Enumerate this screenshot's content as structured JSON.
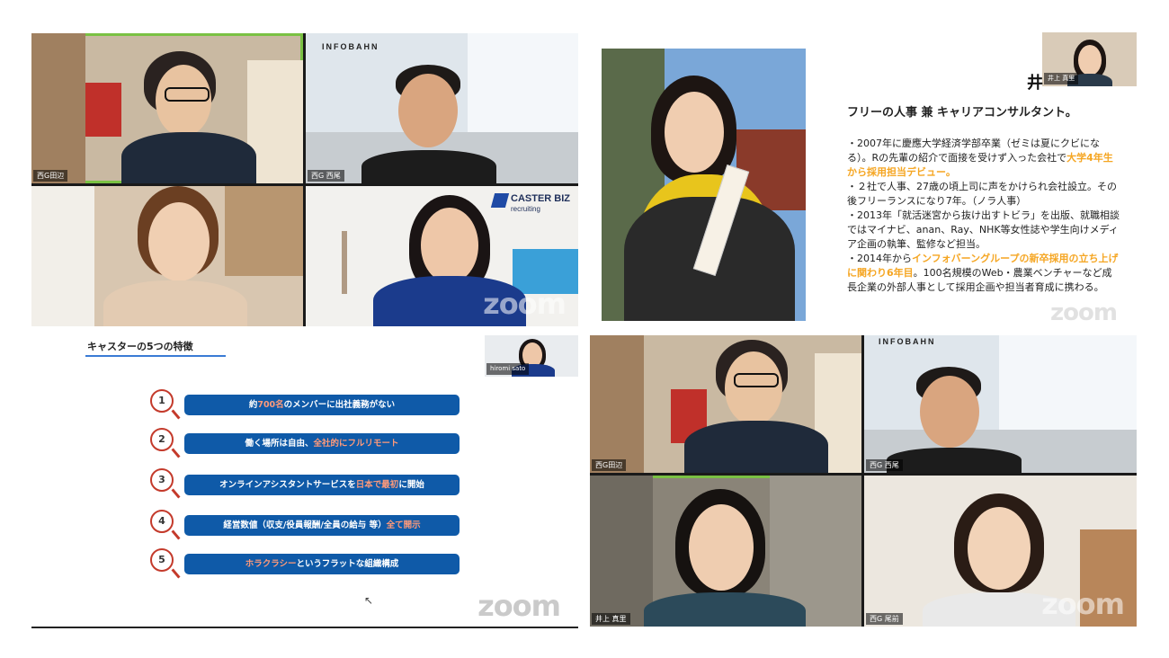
{
  "top_left_grid": {
    "tiles": [
      {
        "name": "西G田辺",
        "highlighted": true
      },
      {
        "name": "西G 西尾",
        "brand": "INFOBAHN"
      },
      {
        "name": ""
      },
      {
        "name": "",
        "brand_line1": "CASTER BIZ",
        "brand_line2": "recruiting"
      }
    ],
    "zoom": "zoom"
  },
  "profile_slide": {
    "name_partial": "井",
    "thumb_name": "井上 真里",
    "headline": "フリーの人事 兼 キャリアコンサルタント。",
    "bullets": [
      {
        "pre": "・2007年に慶應大学経済学部卒業（ゼミは夏にクビになる）。Rの先輩の紹介で面接を受けず入った会社で",
        "hi": "大学4年生から採用担当デビュー。",
        "post": ""
      },
      {
        "pre": "・２社で人事、27歳の頃上司に声をかけられ会社設立。その後フリーランスになり7年。（ノラ人事）",
        "hi": "",
        "post": ""
      },
      {
        "pre": "・2013年「就活迷宮から抜け出すトビラ」を出版、就職相談ではマイナビ、anan、Ray、NHK等女性誌や学生向けメディア企画の執筆、監修など担当。",
        "hi": "",
        "post": ""
      },
      {
        "pre": "・2014年から",
        "hi": "インフォバーングループの新卒採用の立ち上げに関わり6年目",
        "post": "。100名規模のWeb・農業ベンチャーなど成長企業の外部人事として採用企画や担当者育成に携わる。"
      }
    ],
    "zoom": "zoom"
  },
  "caster_slide": {
    "title": "キャスターの5つの特徴",
    "thumb_name": "hiromi sato",
    "features": [
      {
        "num": "1",
        "pre": "約",
        "hi": "700名",
        "post": "のメンバーに出社義務がない"
      },
      {
        "num": "2",
        "pre": "働く場所は自由、",
        "hi": "全社的にフルリモート",
        "post": ""
      },
      {
        "num": "3",
        "pre": "オンラインアシスタントサービスを",
        "hi": "日本で最初",
        "post": "に開始"
      },
      {
        "num": "4",
        "pre": "経営数値（収支/役員報酬/全員の給与 等）",
        "hi": "全て開示",
        "post": ""
      },
      {
        "num": "5",
        "pre": "",
        "hi": "ホラクラシー",
        "post": "というフラットな組織構成"
      }
    ],
    "zoom": "zoom"
  },
  "bottom_right_grid": {
    "tiles": [
      {
        "name": "西G田辺"
      },
      {
        "name": "西G 西尾",
        "brand": "INFOBAHN"
      },
      {
        "name": "井上 真里",
        "highlighted": true
      },
      {
        "name": "西G 尾前"
      }
    ],
    "zoom": "zoom"
  },
  "colors": {
    "highlight_border": "#7ac143",
    "feature_blue": "#0f5aa8",
    "accent_orange": "#f5a623"
  }
}
